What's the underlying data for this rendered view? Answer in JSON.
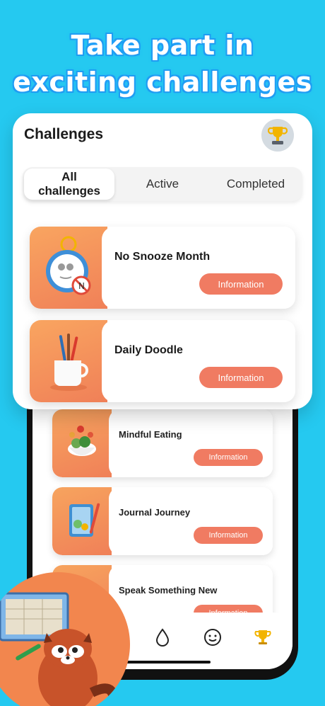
{
  "headline": {
    "line1": "Take part in",
    "line2": "exciting challenges"
  },
  "screen": {
    "title": "Challenges",
    "tabs": [
      {
        "label": "All challenges",
        "active": true
      },
      {
        "label": "Active",
        "active": false
      },
      {
        "label": "Completed",
        "active": false
      }
    ],
    "featured": [
      {
        "title": "No Snooze Month",
        "button": "Information",
        "icon": "stopwatch-icon"
      },
      {
        "title": "Daily Doodle",
        "button": "Information",
        "icon": "pencil-cup-icon"
      }
    ],
    "list": [
      {
        "title": "Mindful Eating",
        "button": "Information",
        "icon": "salad-bowl-icon"
      },
      {
        "title": "Journal Journey",
        "button": "Information",
        "icon": "notebook-icon"
      },
      {
        "title": "Speak Something New",
        "button": "Information",
        "icon": "speech-icon"
      }
    ]
  },
  "tabbar": {
    "items": [
      "drop-icon",
      "smile-icon",
      "trophy-icon"
    ],
    "active": "trophy-icon"
  },
  "colors": {
    "background": "#25c9f0",
    "accent": "#f07b62",
    "thumb_gradient_start": "#f9a560",
    "thumb_gradient_end": "#f08058",
    "trophy": "#f2b400"
  }
}
